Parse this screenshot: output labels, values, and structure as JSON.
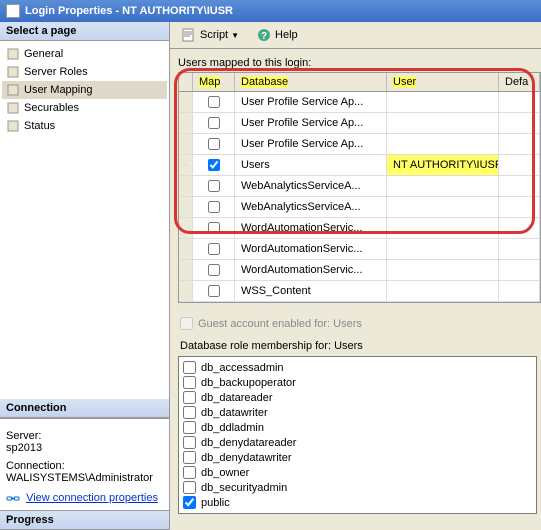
{
  "window": {
    "title": "Login Properties - NT AUTHORITY\\IUSR"
  },
  "sidebar": {
    "header": "Select a page",
    "items": [
      {
        "label": "General"
      },
      {
        "label": "Server Roles"
      },
      {
        "label": "User Mapping"
      },
      {
        "label": "Securables"
      },
      {
        "label": "Status"
      }
    ]
  },
  "connection": {
    "header": "Connection",
    "server_label": "Server:",
    "server_value": "sp2013",
    "conn_label": "Connection:",
    "conn_value": "WALISYSTEMS\\Administrator",
    "view_link": "View connection properties"
  },
  "progress": {
    "header": "Progress"
  },
  "toolbar": {
    "script": "Script",
    "help": "Help"
  },
  "mapping": {
    "group_label": "Users mapped to this login:",
    "cols": {
      "map": "Map",
      "db": "Database",
      "user": "User",
      "def": "Defa"
    },
    "rows": [
      {
        "checked": false,
        "db": "User Profile Service Ap...",
        "user": ""
      },
      {
        "checked": false,
        "db": "User Profile Service Ap...",
        "user": ""
      },
      {
        "checked": false,
        "db": "User Profile Service Ap...",
        "user": ""
      },
      {
        "checked": true,
        "db": "Users",
        "user": "NT AUTHORITY\\IUSR"
      },
      {
        "checked": false,
        "db": "WebAnalyticsServiceA...",
        "user": ""
      },
      {
        "checked": false,
        "db": "WebAnalyticsServiceA...",
        "user": ""
      },
      {
        "checked": false,
        "db": "WordAutomationServic...",
        "user": ""
      },
      {
        "checked": false,
        "db": "WordAutomationServic...",
        "user": ""
      },
      {
        "checked": false,
        "db": "WordAutomationServic...",
        "user": ""
      },
      {
        "checked": false,
        "db": "WSS_Content",
        "user": ""
      }
    ]
  },
  "guest": {
    "label": "Guest account enabled for: Users",
    "checked": false
  },
  "roles": {
    "label": "Database role membership for: Users",
    "items": [
      {
        "name": "db_accessadmin",
        "checked": false
      },
      {
        "name": "db_backupoperator",
        "checked": false
      },
      {
        "name": "db_datareader",
        "checked": false
      },
      {
        "name": "db_datawriter",
        "checked": false
      },
      {
        "name": "db_ddladmin",
        "checked": false
      },
      {
        "name": "db_denydatareader",
        "checked": false
      },
      {
        "name": "db_denydatawriter",
        "checked": false
      },
      {
        "name": "db_owner",
        "checked": false
      },
      {
        "name": "db_securityadmin",
        "checked": false
      },
      {
        "name": "public",
        "checked": true
      }
    ]
  }
}
